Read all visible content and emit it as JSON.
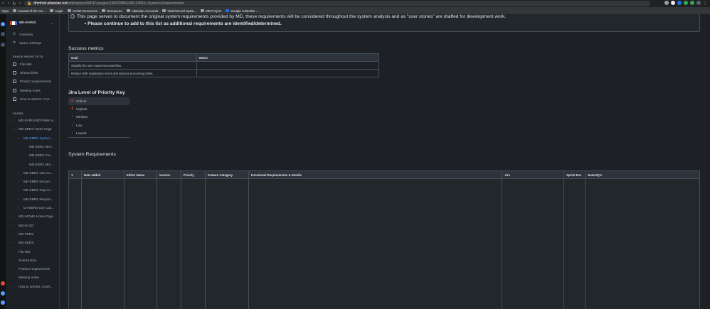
{
  "browser": {
    "url_host": "dhmhoit.atlassian.net",
    "url_path": "/wiki/spaces/MDEV/pages/1400008BG/MD-EBRS+System+Requirements",
    "bookmarks": [
      "Apps",
      "Journal of the Am...",
      "Angie",
      "UCSD Resources",
      "Resources",
      "Atlassian Accounts",
      "Vital Record Syste...",
      "MD Project",
      "Google Calendar -..."
    ]
  },
  "sidebar": {
    "space_name": "MD-EVRIS",
    "top_items": [
      "Overview",
      "Space Settings"
    ],
    "shortcuts_title": "SPACE SHORTCUTS",
    "shortcuts": [
      "File lists",
      "Shared links",
      "Product requirements",
      "Meeting notes",
      "How-to articles: Con..."
    ],
    "pages_title": "PAGES",
    "pages": [
      {
        "label": "MD-EVRIS/MDTHiNK H...",
        "level": 0,
        "twisty": "›"
      },
      {
        "label": "MD-EBRS Home Page",
        "level": 0,
        "twisty": "⌄"
      },
      {
        "label": "MD-EBRS System ...",
        "level": 1,
        "twisty": "⌄",
        "active": true
      },
      {
        "label": "MD-EBRS Mee...",
        "level": 2,
        "twisty": ""
      },
      {
        "label": "MD-EBRS Cre...",
        "level": 2,
        "twisty": ""
      },
      {
        "label": "MD-EBRS Mor...",
        "level": 2,
        "twisty": ""
      },
      {
        "label": "MD-EBRS Use Ca...",
        "level": 1,
        "twisty": "›"
      },
      {
        "label": "MD-EBRS Docum...",
        "level": 1,
        "twisty": "›"
      },
      {
        "label": "MD-EBRS Gap An...",
        "level": 1,
        "twisty": "›"
      },
      {
        "label": "MD-EBRS Require...",
        "level": 1,
        "twisty": "›"
      },
      {
        "label": "CA-EBRS Use Cas...",
        "level": 1,
        "twisty": "›"
      },
      {
        "label": "MD-WOMS Home Page",
        "level": 0,
        "twisty": "›"
      },
      {
        "label": "MD-eCOD",
        "level": 0,
        "twisty": "›"
      },
      {
        "label": "MD-FDRS",
        "level": 0,
        "twisty": "›"
      },
      {
        "label": "MD-EDRS",
        "level": 0,
        "twisty": "›"
      },
      {
        "label": "File lists",
        "level": 0,
        "twisty": "›"
      },
      {
        "label": "Shared links",
        "level": 0,
        "twisty": "›"
      },
      {
        "label": "Product requirements",
        "level": 0,
        "twisty": "›"
      },
      {
        "label": "Meeting notes",
        "level": 0,
        "twisty": "›"
      },
      {
        "label": "How-to articles: Confl...",
        "level": 0,
        "twisty": "›"
      }
    ]
  },
  "main": {
    "info_text": "This page serves to document the original system requirements provided by MD, these requirements will be considered throughout the system analysis and as \"user stories\" are drafted for development work.",
    "info_bullet": "Please continue to add to this list as additional requirements are identified/determined.",
    "success_title": "Success metrics",
    "metrics_headers": [
      "Goal",
      "Metric"
    ],
    "metrics_rows": [
      [
        "Simplify the user experience/workflow.",
        ""
      ],
      [
        "Reduce birth registration errors and improve processing times.",
        ""
      ]
    ],
    "priority_title": "Jira Level of Priority Key",
    "priorities": [
      {
        "label": "Critical",
        "icon": "⊘",
        "color": "#e34935"
      },
      {
        "label": "Highest",
        "icon": "⬆",
        "color": "#e34935"
      },
      {
        "label": "Medium",
        "icon": "↑",
        "color": "#f5a623"
      },
      {
        "label": "Low",
        "icon": "↓",
        "color": "#579dff"
      },
      {
        "label": "Lowest",
        "icon": "↓",
        "color": "#579dff"
      }
    ],
    "requirements_title": "System Requirements",
    "requirements_headers": [
      "1",
      "Date added",
      "Editor Name",
      "Version",
      "Priority",
      "Feature Category",
      "Functional Requirements & Details",
      "Jira",
      "Sprint Est.",
      "Notes/Q's"
    ]
  }
}
